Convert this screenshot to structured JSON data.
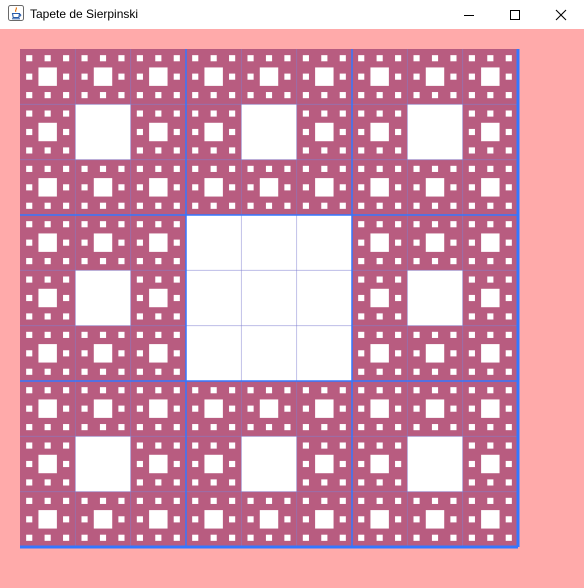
{
  "window": {
    "title": "Tapete de Sierpinski",
    "app_icon": "java-icon",
    "controls": {
      "minimize_icon": "minimize-icon",
      "maximize_icon": "maximize-icon",
      "close_icon": "close-icon"
    }
  },
  "carpet": {
    "recursion_depth": 4,
    "colors": {
      "background": "#ffaaaa",
      "fill": "#b85c80",
      "hole": "#ffffff",
      "grid_line": "#7f7fd0",
      "border": "#3377ff"
    }
  }
}
